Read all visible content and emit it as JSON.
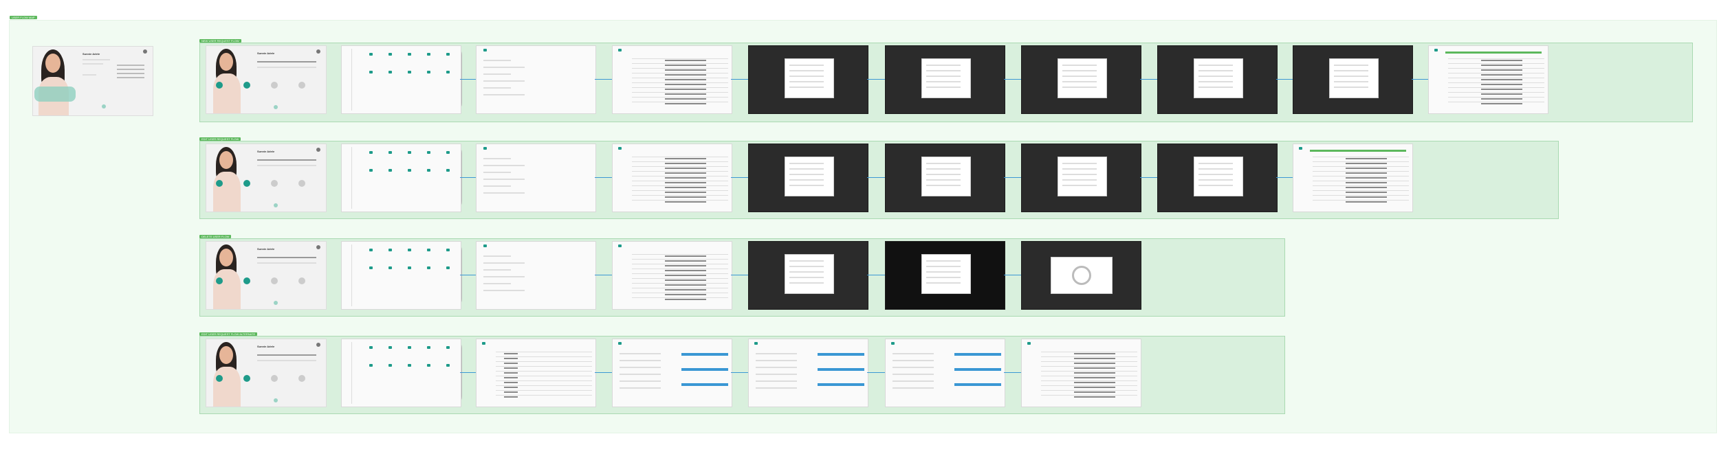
{
  "frames": {
    "top_label": "USER FLOW MAP",
    "rows": [
      {
        "tag": "NEW USER REQUEST FLOW",
        "request_label": "New User Request"
      },
      {
        "tag": "EDIT USER REQUEST FLOW",
        "request_label": "Edit User Request"
      },
      {
        "tag": "DELETE USER FLOW",
        "request_label": "Delete User Request"
      },
      {
        "tag": "EDIT USER REQUEST FLOW ALTERNATE",
        "request_label": "Edit User Request"
      }
    ]
  },
  "persona": {
    "name": "Sunnie Adele"
  },
  "colors": {
    "accent": "#1e9b8a",
    "frame_green": "#5cb85c",
    "connector_blue": "#3a97d4"
  },
  "icons": {
    "request": "chevron-down-icon"
  }
}
